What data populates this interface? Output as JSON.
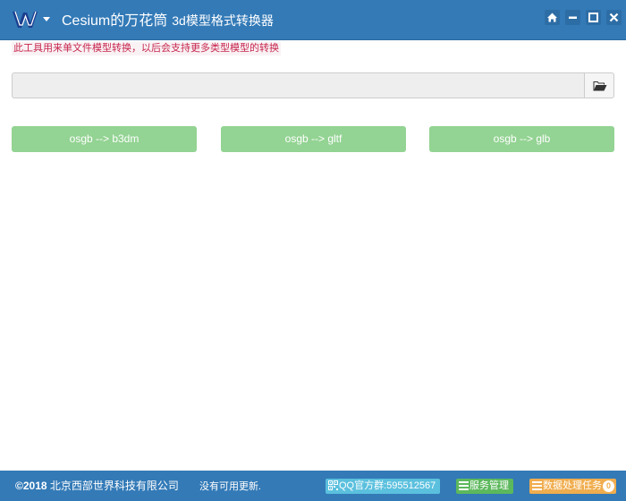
{
  "titlebar": {
    "app_name": "Cesium的万花筒",
    "subtitle": "3d模型格式转换器",
    "logo_icon": "w-logo-icon",
    "buttons": [
      "home-icon",
      "minimize-icon",
      "maximize-icon",
      "close-icon"
    ]
  },
  "notice": "此工具用来单文件模型转换，以后会支持更多类型模型的转换",
  "path_field": {
    "value": "",
    "placeholder": "",
    "browse_icon": "folder-open-icon"
  },
  "convert_buttons": [
    "osgb --> b3dm",
    "osgb --> gltf",
    "osgb --> glb"
  ],
  "statusbar": {
    "copyright_symbol": "©2018",
    "company": " 北京西部世界科技有限公司",
    "update_message": "没有可用更新.",
    "qq_group": "QQ官方群:595512567",
    "service_mgmt": "服务管理",
    "data_tasks": "数据处理任务",
    "task_count": "0"
  },
  "colors": {
    "titlebar": "#337ab7",
    "convert_button": "#93d393",
    "notice_text": "#c7254e",
    "badge_info": "#5bc0de",
    "badge_success": "#5cb85c",
    "badge_warning": "#f0ad4e"
  }
}
